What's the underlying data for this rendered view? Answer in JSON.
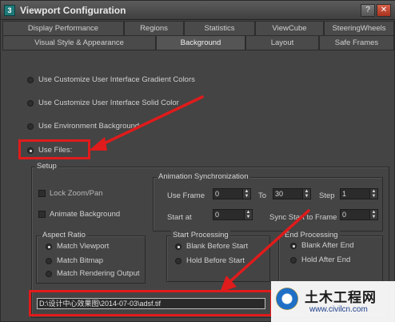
{
  "window": {
    "title": "Viewport Configuration",
    "help_label": "?",
    "close_label": "✕"
  },
  "tabs": {
    "row1": [
      "Display Performance",
      "Regions",
      "Statistics",
      "ViewCube",
      "SteeringWheels"
    ],
    "row2": [
      "Visual Style & Appearance",
      "Background",
      "Layout",
      "Safe Frames"
    ],
    "active": "Background"
  },
  "background_options": {
    "gradient": "Use Customize User Interface Gradient Colors",
    "solid": "Use Customize User Interface Solid Color",
    "environment": "Use Environment Background",
    "files": "Use Files:",
    "selected": "files"
  },
  "setup": {
    "title": "Setup",
    "lock_zoom_pan": "Lock Zoom/Pan",
    "animate_background": "Animate Background"
  },
  "animation_sync": {
    "title": "Animation Synchronization",
    "use_frame_label": "Use Frame",
    "use_frame_value": "0",
    "to_label": "To",
    "to_value": "30",
    "step_label": "Step",
    "step_value": "1",
    "start_at_label": "Start at",
    "start_at_value": "0",
    "sync_start_label": "Sync Start to Frame",
    "sync_start_value": "0"
  },
  "aspect_ratio": {
    "title": "Aspect Ratio",
    "options": [
      "Match Viewport",
      "Match Bitmap",
      "Match Rendering Output"
    ],
    "selected": 0
  },
  "start_processing": {
    "title": "Start Processing",
    "options": [
      "Blank Before Start",
      "Hold Before Start"
    ],
    "selected": 0
  },
  "end_processing": {
    "title": "End Processing",
    "options": [
      "Blank After End",
      "Hold After End"
    ],
    "selected": 0
  },
  "file_path": "D:\\设计中心效果图\\2014-07-03\\adsf.tif",
  "watermark": {
    "title": "土木工程网",
    "url": "www.civilcn.com"
  },
  "colors": {
    "annotation": "#e01b1b",
    "panel": "#444444"
  }
}
